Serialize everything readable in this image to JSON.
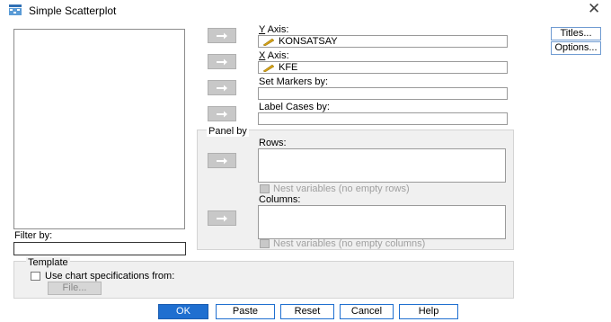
{
  "window": {
    "title": "Simple Scatterplot"
  },
  "source_list": {
    "filter_label": "Filter by:",
    "filter_value": ""
  },
  "y_axis": {
    "label": "Y Axis:",
    "value": "KONSATSAY"
  },
  "x_axis": {
    "label": "X Axis:",
    "value": "KFE"
  },
  "set_markers": {
    "label": "Set Markers by:",
    "value": ""
  },
  "label_cases": {
    "label": "Label Cases by:",
    "value": ""
  },
  "panel": {
    "title": "Panel by",
    "rows_label": "Rows:",
    "nest_rows": "Nest variables (no empty rows)",
    "columns_label": "Columns:",
    "nest_columns": "Nest variables (no empty columns)"
  },
  "side_buttons": {
    "titles": "Titles...",
    "options": "Options..."
  },
  "template": {
    "title": "Template",
    "use_spec": "Use chart specifications from:",
    "file_button": "File..."
  },
  "buttons": {
    "ok": "OK",
    "paste": "Paste",
    "reset": "Reset",
    "cancel": "Cancel",
    "help": "Help"
  },
  "colors": {
    "accent": "#1f6fd0",
    "arrow_button": "#c8c8c8",
    "group_bg": "#f0f0f0",
    "measure_icon": "#d4a017"
  }
}
